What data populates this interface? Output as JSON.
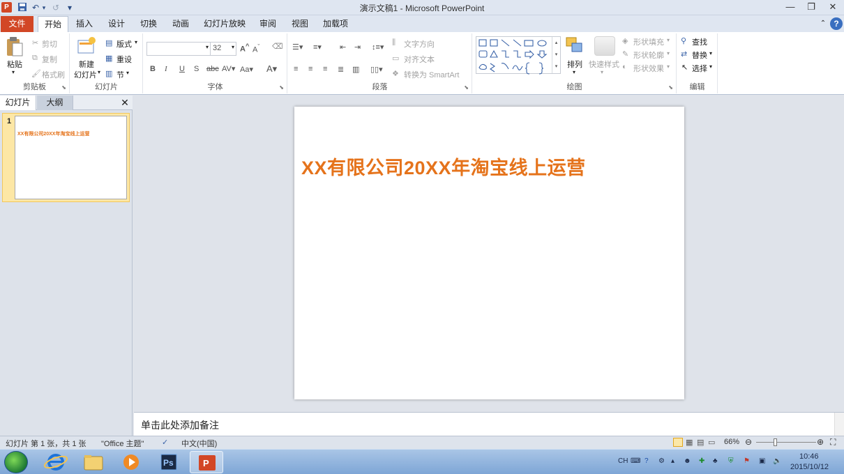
{
  "window": {
    "title": "演示文稿1 - Microsoft PowerPoint",
    "app_icon": "P"
  },
  "qat": {
    "undo": "↶",
    "redo": "↺",
    "customize": "▾"
  },
  "tabs": [
    {
      "label": "文件"
    },
    {
      "label": "开始"
    },
    {
      "label": "插入"
    },
    {
      "label": "设计"
    },
    {
      "label": "切换"
    },
    {
      "label": "动画"
    },
    {
      "label": "幻灯片放映"
    },
    {
      "label": "审阅"
    },
    {
      "label": "视图"
    },
    {
      "label": "加载项"
    }
  ],
  "ribbon": {
    "clipboard": {
      "label": "剪贴板",
      "paste": "粘贴",
      "cut": "剪切",
      "copy": "复制",
      "format_painter": "格式刷"
    },
    "slides": {
      "label": "幻灯片",
      "new_slide": "新建",
      "new_slide2": "幻灯片",
      "layout": "版式",
      "reset": "重设",
      "section": "节"
    },
    "font": {
      "label": "字体",
      "font_name": "",
      "font_size": "32"
    },
    "paragraph": {
      "label": "段落",
      "text_direction": "文字方向",
      "align_text": "对齐文本",
      "smartart": "转换为 SmartArt"
    },
    "drawing": {
      "label": "绘图",
      "arrange": "排列",
      "quick_styles": "快速样式",
      "shape_fill": "形状填充",
      "shape_outline": "形状轮廓",
      "shape_effects": "形状效果"
    },
    "editing": {
      "label": "编辑",
      "find": "查找",
      "replace": "替换",
      "select": "选择"
    }
  },
  "panel": {
    "tab_slides": "幻灯片",
    "tab_outline": "大纲",
    "slide_number": "1"
  },
  "slide": {
    "title": "XX有限公司20XX年淘宝线上运营"
  },
  "notes": {
    "placeholder": "单击此处添加备注"
  },
  "status": {
    "slide_info": "幻灯片 第 1 张，共 1 张",
    "theme": "\"Office 主题\"",
    "language": "中文(中国)",
    "zoom": "66%",
    "zoom_value": 66
  },
  "taskbar": {
    "lang": "CH",
    "time": "10:46",
    "date": "2015/10/12"
  },
  "colors": {
    "accent": "#d24726",
    "title_orange": "#e5731b"
  }
}
